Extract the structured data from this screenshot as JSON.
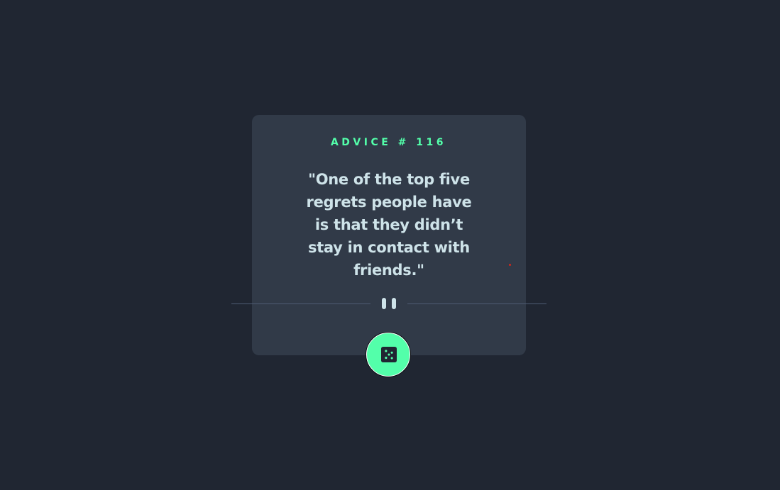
{
  "advice": {
    "id_label": "ADVICE # 116",
    "quote": "\"One of the top five regrets people have is that they didn’t stay in contact with friends.\""
  },
  "divider": {
    "icon": "pause-icon"
  },
  "dice_button": {
    "icon": "dice-icon"
  },
  "colors": {
    "background": "#202632",
    "card": "#313a48",
    "accent": "#53ffaa",
    "text": "#cee3e9",
    "divider": "#4f5d74"
  }
}
